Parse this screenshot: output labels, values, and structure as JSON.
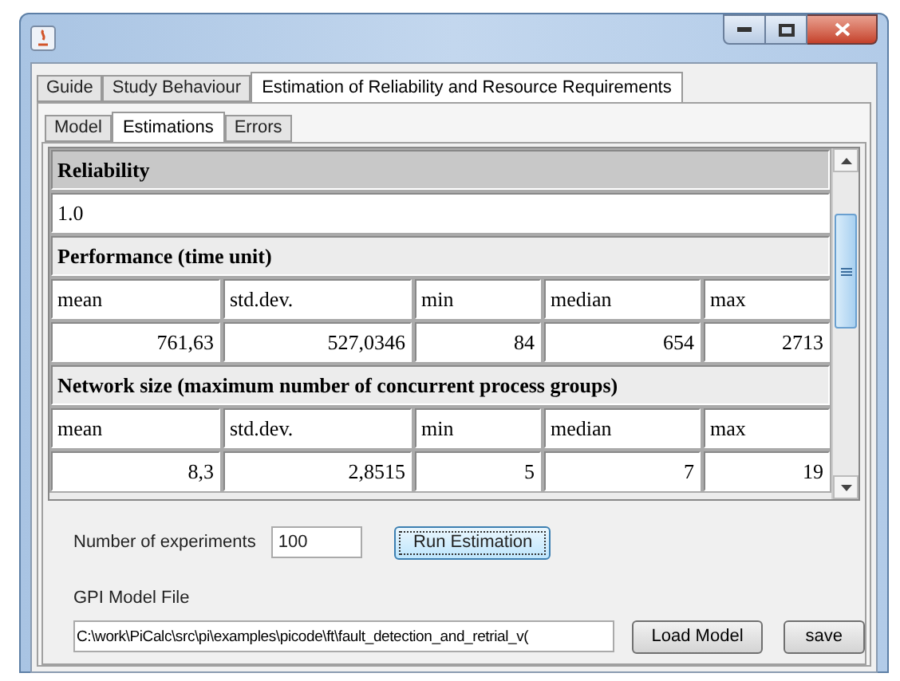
{
  "outer_tabs": [
    {
      "label": "Guide",
      "selected": false
    },
    {
      "label": "Study Behaviour",
      "selected": false
    },
    {
      "label": "Estimation of Reliability and Resource Requirements",
      "selected": true
    }
  ],
  "inner_tabs": [
    {
      "label": "Model",
      "selected": false
    },
    {
      "label": "Estimations",
      "selected": true
    },
    {
      "label": "Errors",
      "selected": false
    }
  ],
  "sections": [
    {
      "kind": "single",
      "title": "Reliability",
      "value": "1.0"
    },
    {
      "kind": "stats",
      "title": "Performance (time unit)",
      "columns": [
        "mean",
        "std.dev.",
        "min",
        "median",
        "max"
      ],
      "values": [
        "761,63",
        "527,0346",
        "84",
        "654",
        "2713"
      ]
    },
    {
      "kind": "stats",
      "title": "Network size (maximum number of concurrent process groups)",
      "columns": [
        "mean",
        "std.dev.",
        "min",
        "median",
        "max"
      ],
      "values": [
        "8,3",
        "2,8515",
        "5",
        "7",
        "19"
      ]
    }
  ],
  "experiments": {
    "label": "Number of experiments",
    "value": "100",
    "button": "Run Estimation"
  },
  "model_file": {
    "label": "GPI Model File",
    "value": "C:\\work\\PiCalc\\src\\pi\\examples\\picode\\ft\\fault_detection_and_retrial_v(",
    "load_button": "Load Model",
    "save_button": "save"
  }
}
